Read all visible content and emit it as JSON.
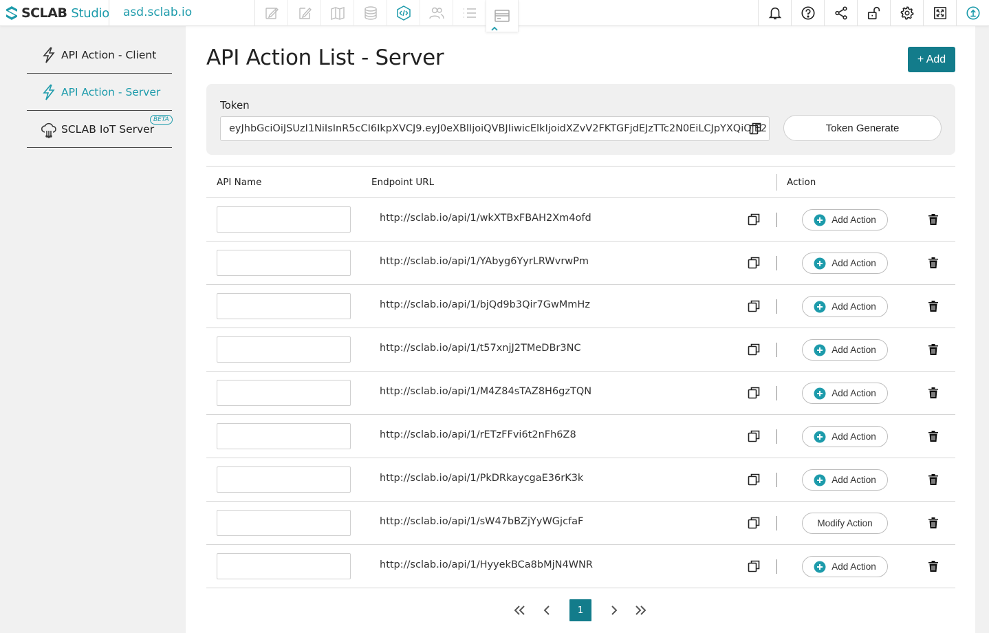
{
  "app": {
    "logo_text": "SCLAB",
    "logo_sub": "Studio",
    "domain": "asd.sclab.io",
    "accent": "#1d9bab",
    "primary": "#137c8b"
  },
  "toolbar": {
    "tools": [
      "edit-doc-icon",
      "pencil-icon",
      "map-icon",
      "database-icon",
      "code-icon",
      "users-icon",
      "list-icon",
      "card-icon"
    ],
    "right": [
      "bell-icon",
      "help-icon",
      "share-icon",
      "unlock-icon",
      "gear-icon",
      "fullscreen-icon",
      "upload-icon"
    ]
  },
  "sidebar": {
    "items": [
      {
        "label": "API Action - Client",
        "icon": "bolt-icon"
      },
      {
        "label": "API Action - Server",
        "icon": "bolt-icon"
      },
      {
        "label": "SCLAB IoT Server",
        "icon": "cloud-icon",
        "badge": "BETA"
      }
    ]
  },
  "main": {
    "title": "API Action List - Server",
    "add_label": "+ Add",
    "token": {
      "label": "Token",
      "value": "eyJhbGciOiJSUzI1NiIsInR5cCI6IkpXVCJ9.eyJ0eXBlIjoiQVBJIiwicElkIjoidXZvV2FKTGFjdEJzTTc2N0EiLCJpYXQiOjE2",
      "generate_label": "Token Generate"
    },
    "table": {
      "headers": {
        "name": "API Name",
        "url": "Endpoint URL",
        "action": "Action"
      },
      "rows": [
        {
          "name": "",
          "url": "http://sclab.io/api/1/wkXTBxFBAH2Xm4ofd",
          "action": "Add Action",
          "has_plus": true
        },
        {
          "name": "",
          "url": "http://sclab.io/api/1/YAbyg6YyrLRWvrwPm",
          "action": "Add Action",
          "has_plus": true
        },
        {
          "name": "",
          "url": "http://sclab.io/api/1/bjQd9b3Qir7GwMmHz",
          "action": "Add Action",
          "has_plus": true
        },
        {
          "name": "",
          "url": "http://sclab.io/api/1/t57xnjJ2TMeDBr3NC",
          "action": "Add Action",
          "has_plus": true
        },
        {
          "name": "",
          "url": "http://sclab.io/api/1/M4Z84sTAZ8H6gzTQN",
          "action": "Add Action",
          "has_plus": true
        },
        {
          "name": "",
          "url": "http://sclab.io/api/1/rETzFFvi6t2nFh6Z8",
          "action": "Add Action",
          "has_plus": true
        },
        {
          "name": "",
          "url": "http://sclab.io/api/1/PkDRkaycgaE36rK3k",
          "action": "Add Action",
          "has_plus": true
        },
        {
          "name": "",
          "url": "http://sclab.io/api/1/sW47bBZjYyWGjcfaF",
          "action": "Modify Action",
          "has_plus": false
        },
        {
          "name": "",
          "url": "http://sclab.io/api/1/HyyekBCa8bMjN4WNR",
          "action": "Add Action",
          "has_plus": true
        }
      ]
    },
    "pagination": {
      "current": "1"
    }
  }
}
